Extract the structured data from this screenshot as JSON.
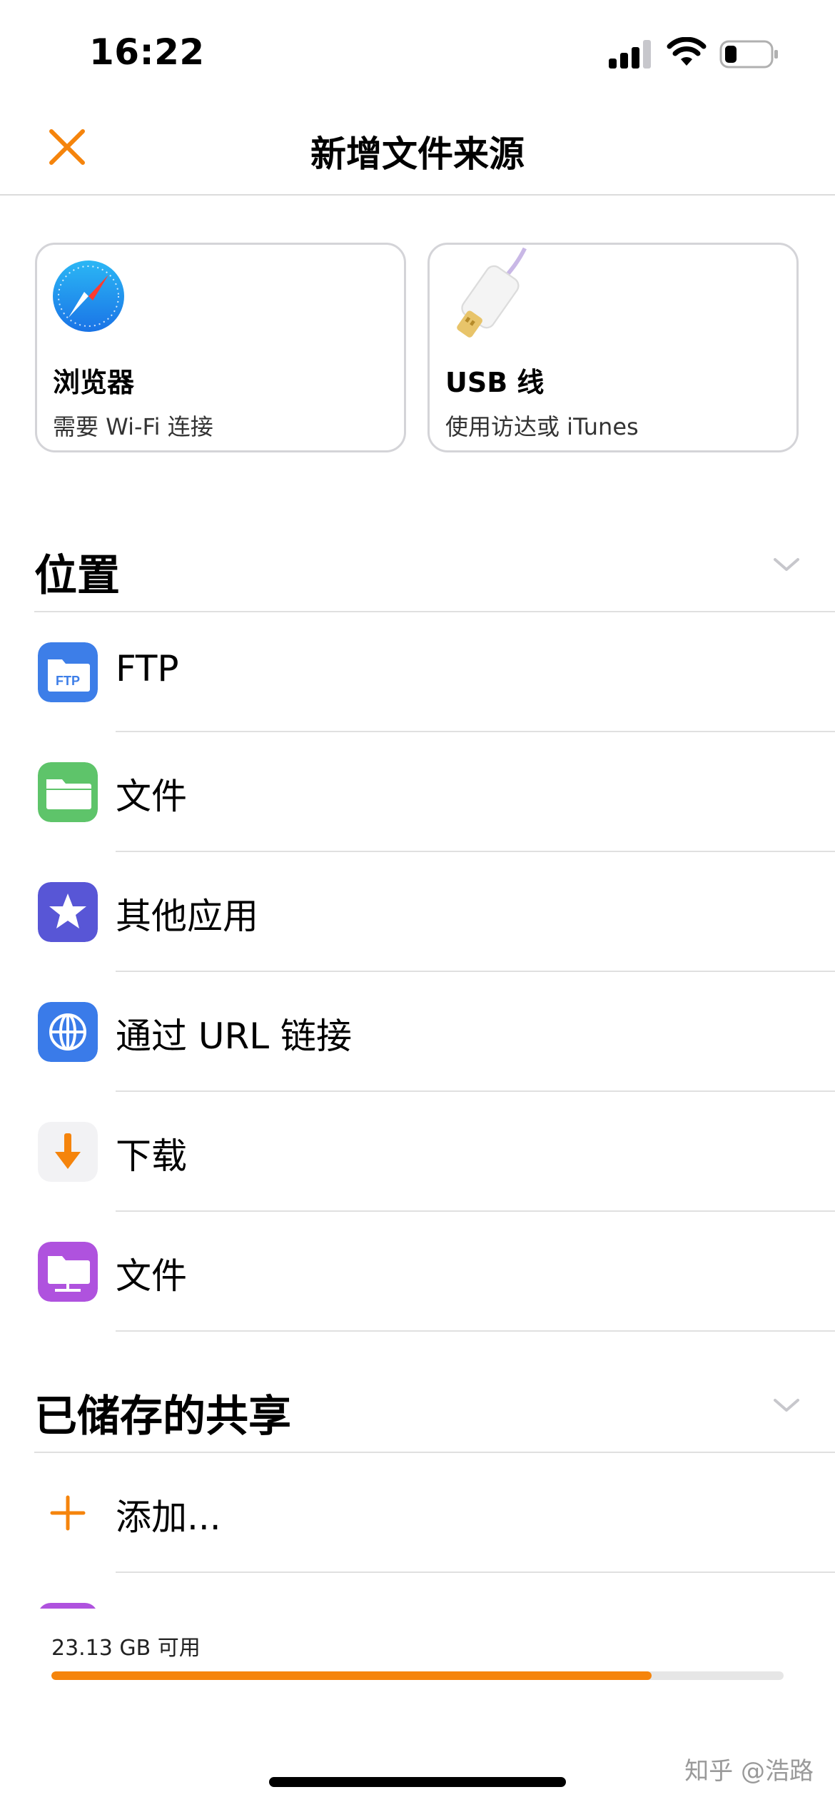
{
  "status_bar": {
    "time": "16:22"
  },
  "nav": {
    "title": "新增文件来源"
  },
  "cards": [
    {
      "title": "浏览器",
      "subtitle": "需要 Wi-Fi 连接",
      "icon": "safari-compass-icon"
    },
    {
      "title": "USB 线",
      "subtitle": "使用访达或 iTunes",
      "icon": "lightning-cable-icon"
    }
  ],
  "sections": {
    "locations": {
      "title": "位置",
      "items": [
        {
          "label": "FTP",
          "icon": "ftp-folder-icon",
          "color": "#3d7ee8",
          "icon_text": "FTP"
        },
        {
          "label": "文件",
          "icon": "files-folder-icon",
          "color": "#5ec46a"
        },
        {
          "label": "其他应用",
          "icon": "star-icon",
          "color": "#5856d6"
        },
        {
          "label": "通过 URL 链接",
          "icon": "globe-icon",
          "color": "#3a7be9"
        },
        {
          "label": "下载",
          "icon": "download-arrow-icon",
          "color": "#f5840c"
        },
        {
          "label": "文件",
          "icon": "network-folder-icon",
          "color": "#af52de"
        }
      ]
    },
    "saved_shares": {
      "title": "已储存的共享",
      "add_label": "添加..."
    }
  },
  "storage": {
    "text": "23.13 GB 可用",
    "used_fraction": 0.82
  },
  "watermark": "知乎 @浩路",
  "colors": {
    "accent": "#f5840c"
  }
}
